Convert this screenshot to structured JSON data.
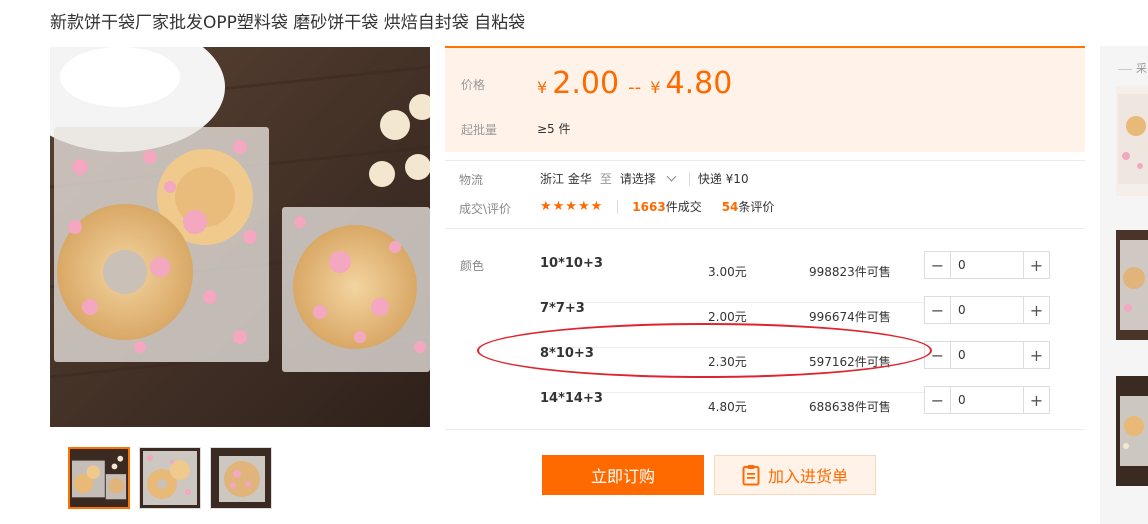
{
  "product": {
    "title": "新款饼干袋厂家批发OPP塑料袋 磨砂饼干袋 烘焙自封袋 自粘袋"
  },
  "price": {
    "label": "价格",
    "currency": "¥",
    "min": "2.00",
    "separator": "--",
    "max": "4.80",
    "moq_label": "起批量",
    "moq_value": "≥5 件"
  },
  "logistics": {
    "label": "物流",
    "origin": "浙江 金华",
    "to": "至",
    "destination_placeholder": "请选择",
    "shipping": "快递 ¥10"
  },
  "deals": {
    "label": "成交\\评价",
    "stars": "★★★★★",
    "deal_count": "1663",
    "deal_suffix": "件成交",
    "review_count": "54",
    "review_suffix": "条评价"
  },
  "sku": {
    "label": "颜色",
    "items": [
      {
        "name": "10*10+3",
        "price": "3.00元",
        "stock": "998823件可售",
        "qty": "0"
      },
      {
        "name": "7*7+3",
        "price": "2.00元",
        "stock": "996674件可售",
        "qty": "0"
      },
      {
        "name": "8*10+3",
        "price": "2.30元",
        "stock": "597162件可售",
        "qty": "0"
      },
      {
        "name": "14*14+3",
        "price": "4.80元",
        "stock": "688638件可售",
        "qty": "0"
      }
    ],
    "minus": "−",
    "plus": "+"
  },
  "actions": {
    "buy": "立即订购",
    "cart": "加入进货单"
  },
  "sidebar": {
    "heading": "采"
  },
  "icons": {
    "cart_icon": "clipboard-list-icon",
    "chevron": "chevron-down-icon"
  },
  "colors": {
    "accent": "#ff6a00",
    "price_bg": "#fff2e8",
    "annotation": "#e0242e"
  }
}
